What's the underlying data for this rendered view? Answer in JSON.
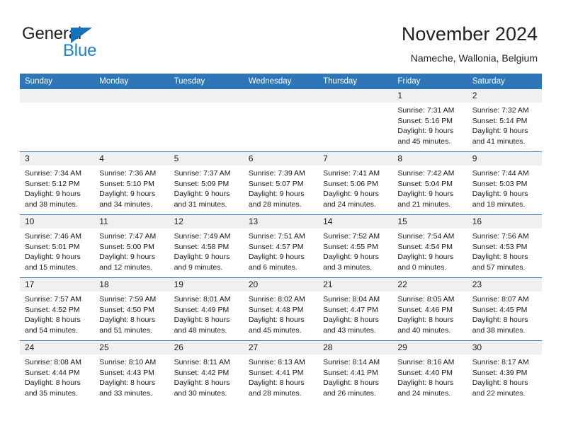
{
  "brand": {
    "name_top": "General",
    "name_bottom": "Blue",
    "triangle_icon": "triangle-icon",
    "color_dark": "#231f20",
    "color_blue": "#1b84c8"
  },
  "header": {
    "title": "November 2024",
    "subtitle": "Nameche, Wallonia, Belgium"
  },
  "theme": {
    "header_blue": "#2e76b8",
    "daynum_strip": "#f0f0f0",
    "body_white": "#ffffff",
    "text": "#1a1a1a"
  },
  "calendar": {
    "weekday_headers": [
      "Sunday",
      "Monday",
      "Tuesday",
      "Wednesday",
      "Thursday",
      "Friday",
      "Saturday"
    ],
    "weeks": [
      [
        {
          "day": "",
          "lines": []
        },
        {
          "day": "",
          "lines": []
        },
        {
          "day": "",
          "lines": []
        },
        {
          "day": "",
          "lines": []
        },
        {
          "day": "",
          "lines": []
        },
        {
          "day": "1",
          "lines": [
            "Sunrise: 7:31 AM",
            "Sunset: 5:16 PM",
            "Daylight: 9 hours",
            "and 45 minutes."
          ]
        },
        {
          "day": "2",
          "lines": [
            "Sunrise: 7:32 AM",
            "Sunset: 5:14 PM",
            "Daylight: 9 hours",
            "and 41 minutes."
          ]
        }
      ],
      [
        {
          "day": "3",
          "lines": [
            "Sunrise: 7:34 AM",
            "Sunset: 5:12 PM",
            "Daylight: 9 hours",
            "and 38 minutes."
          ]
        },
        {
          "day": "4",
          "lines": [
            "Sunrise: 7:36 AM",
            "Sunset: 5:10 PM",
            "Daylight: 9 hours",
            "and 34 minutes."
          ]
        },
        {
          "day": "5",
          "lines": [
            "Sunrise: 7:37 AM",
            "Sunset: 5:09 PM",
            "Daylight: 9 hours",
            "and 31 minutes."
          ]
        },
        {
          "day": "6",
          "lines": [
            "Sunrise: 7:39 AM",
            "Sunset: 5:07 PM",
            "Daylight: 9 hours",
            "and 28 minutes."
          ]
        },
        {
          "day": "7",
          "lines": [
            "Sunrise: 7:41 AM",
            "Sunset: 5:06 PM",
            "Daylight: 9 hours",
            "and 24 minutes."
          ]
        },
        {
          "day": "8",
          "lines": [
            "Sunrise: 7:42 AM",
            "Sunset: 5:04 PM",
            "Daylight: 9 hours",
            "and 21 minutes."
          ]
        },
        {
          "day": "9",
          "lines": [
            "Sunrise: 7:44 AM",
            "Sunset: 5:03 PM",
            "Daylight: 9 hours",
            "and 18 minutes."
          ]
        }
      ],
      [
        {
          "day": "10",
          "lines": [
            "Sunrise: 7:46 AM",
            "Sunset: 5:01 PM",
            "Daylight: 9 hours",
            "and 15 minutes."
          ]
        },
        {
          "day": "11",
          "lines": [
            "Sunrise: 7:47 AM",
            "Sunset: 5:00 PM",
            "Daylight: 9 hours",
            "and 12 minutes."
          ]
        },
        {
          "day": "12",
          "lines": [
            "Sunrise: 7:49 AM",
            "Sunset: 4:58 PM",
            "Daylight: 9 hours",
            "and 9 minutes."
          ]
        },
        {
          "day": "13",
          "lines": [
            "Sunrise: 7:51 AM",
            "Sunset: 4:57 PM",
            "Daylight: 9 hours",
            "and 6 minutes."
          ]
        },
        {
          "day": "14",
          "lines": [
            "Sunrise: 7:52 AM",
            "Sunset: 4:55 PM",
            "Daylight: 9 hours",
            "and 3 minutes."
          ]
        },
        {
          "day": "15",
          "lines": [
            "Sunrise: 7:54 AM",
            "Sunset: 4:54 PM",
            "Daylight: 9 hours",
            "and 0 minutes."
          ]
        },
        {
          "day": "16",
          "lines": [
            "Sunrise: 7:56 AM",
            "Sunset: 4:53 PM",
            "Daylight: 8 hours",
            "and 57 minutes."
          ]
        }
      ],
      [
        {
          "day": "17",
          "lines": [
            "Sunrise: 7:57 AM",
            "Sunset: 4:52 PM",
            "Daylight: 8 hours",
            "and 54 minutes."
          ]
        },
        {
          "day": "18",
          "lines": [
            "Sunrise: 7:59 AM",
            "Sunset: 4:50 PM",
            "Daylight: 8 hours",
            "and 51 minutes."
          ]
        },
        {
          "day": "19",
          "lines": [
            "Sunrise: 8:01 AM",
            "Sunset: 4:49 PM",
            "Daylight: 8 hours",
            "and 48 minutes."
          ]
        },
        {
          "day": "20",
          "lines": [
            "Sunrise: 8:02 AM",
            "Sunset: 4:48 PM",
            "Daylight: 8 hours",
            "and 45 minutes."
          ]
        },
        {
          "day": "21",
          "lines": [
            "Sunrise: 8:04 AM",
            "Sunset: 4:47 PM",
            "Daylight: 8 hours",
            "and 43 minutes."
          ]
        },
        {
          "day": "22",
          "lines": [
            "Sunrise: 8:05 AM",
            "Sunset: 4:46 PM",
            "Daylight: 8 hours",
            "and 40 minutes."
          ]
        },
        {
          "day": "23",
          "lines": [
            "Sunrise: 8:07 AM",
            "Sunset: 4:45 PM",
            "Daylight: 8 hours",
            "and 38 minutes."
          ]
        }
      ],
      [
        {
          "day": "24",
          "lines": [
            "Sunrise: 8:08 AM",
            "Sunset: 4:44 PM",
            "Daylight: 8 hours",
            "and 35 minutes."
          ]
        },
        {
          "day": "25",
          "lines": [
            "Sunrise: 8:10 AM",
            "Sunset: 4:43 PM",
            "Daylight: 8 hours",
            "and 33 minutes."
          ]
        },
        {
          "day": "26",
          "lines": [
            "Sunrise: 8:11 AM",
            "Sunset: 4:42 PM",
            "Daylight: 8 hours",
            "and 30 minutes."
          ]
        },
        {
          "day": "27",
          "lines": [
            "Sunrise: 8:13 AM",
            "Sunset: 4:41 PM",
            "Daylight: 8 hours",
            "and 28 minutes."
          ]
        },
        {
          "day": "28",
          "lines": [
            "Sunrise: 8:14 AM",
            "Sunset: 4:41 PM",
            "Daylight: 8 hours",
            "and 26 minutes."
          ]
        },
        {
          "day": "29",
          "lines": [
            "Sunrise: 8:16 AM",
            "Sunset: 4:40 PM",
            "Daylight: 8 hours",
            "and 24 minutes."
          ]
        },
        {
          "day": "30",
          "lines": [
            "Sunrise: 8:17 AM",
            "Sunset: 4:39 PM",
            "Daylight: 8 hours",
            "and 22 minutes."
          ]
        }
      ]
    ]
  }
}
